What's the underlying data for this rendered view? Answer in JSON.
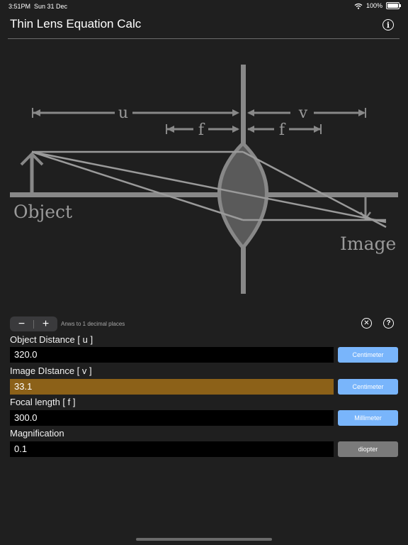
{
  "status": {
    "time": "3:51PM",
    "date": "Sun 31 Dec",
    "battery": "100%"
  },
  "app": {
    "title": "Thin Lens Equation Calc"
  },
  "diagram": {
    "labels": {
      "u": "u",
      "v": "v",
      "f_left": "f",
      "f_right": "f",
      "object": "Object",
      "image": "Image"
    }
  },
  "controls": {
    "minus": "−",
    "plus": "+",
    "decimals_text": "Anws to 1 decimal places",
    "clear_symbol": "✕",
    "help_symbol": "?"
  },
  "fields": {
    "object_distance": {
      "label": "Object Distance [ u ]",
      "value": "320.0",
      "unit": "Centimeter"
    },
    "image_distance": {
      "label": "Image DIstance [ v ]",
      "value": "33.1",
      "unit": "Centimeter"
    },
    "focal_length": {
      "label": "Focal length [ f ]",
      "value": "300.0",
      "unit": "Millimeter"
    },
    "magnification": {
      "label": "Magnification",
      "value": "0.1",
      "unit": "diopter"
    }
  },
  "colors": {
    "background": "#1f1f1f",
    "diagram_gray": "#888888",
    "highlight_field": "#8c6118",
    "unit_button_blue": "#79b5fb",
    "unit_button_gray": "#7a7a7a"
  },
  "icons": {
    "wifi": "wifi-icon",
    "battery": "battery-icon",
    "info": "info-icon",
    "clear": "clear-circle-x-icon",
    "help": "help-question-icon"
  }
}
